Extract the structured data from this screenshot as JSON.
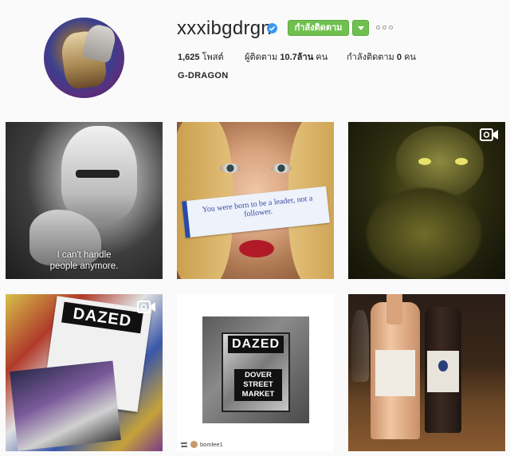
{
  "profile": {
    "username": "xxxibgdrgn",
    "verified": true,
    "follow_label": "กำลังติดตาม",
    "full_name": "G-DRAGON",
    "accent_color": "#70c050"
  },
  "stats": {
    "posts_value": "1,625",
    "posts_label": "โพสต์",
    "followers_label": "ผู้ติดตาม",
    "followers_value": "10.7ล้าน",
    "followers_unit": "คน",
    "following_label": "กำลังติดตาม",
    "following_value": "0",
    "following_unit": "คน"
  },
  "posts": [
    {
      "caption_line1": "I can't handle",
      "caption_line2": "people anymore.",
      "video": false
    },
    {
      "fortune_text": "You were born to be a leader, not a follower.",
      "video": false
    },
    {
      "video": true
    },
    {
      "magazine_title": "DAZED",
      "video": true
    },
    {
      "magazine_title": "DAZED",
      "store_line1": "DOVER",
      "store_line2": "STREET",
      "store_line3": "MARKET",
      "credit": "bomlee1",
      "video": false
    },
    {
      "video": false
    }
  ]
}
